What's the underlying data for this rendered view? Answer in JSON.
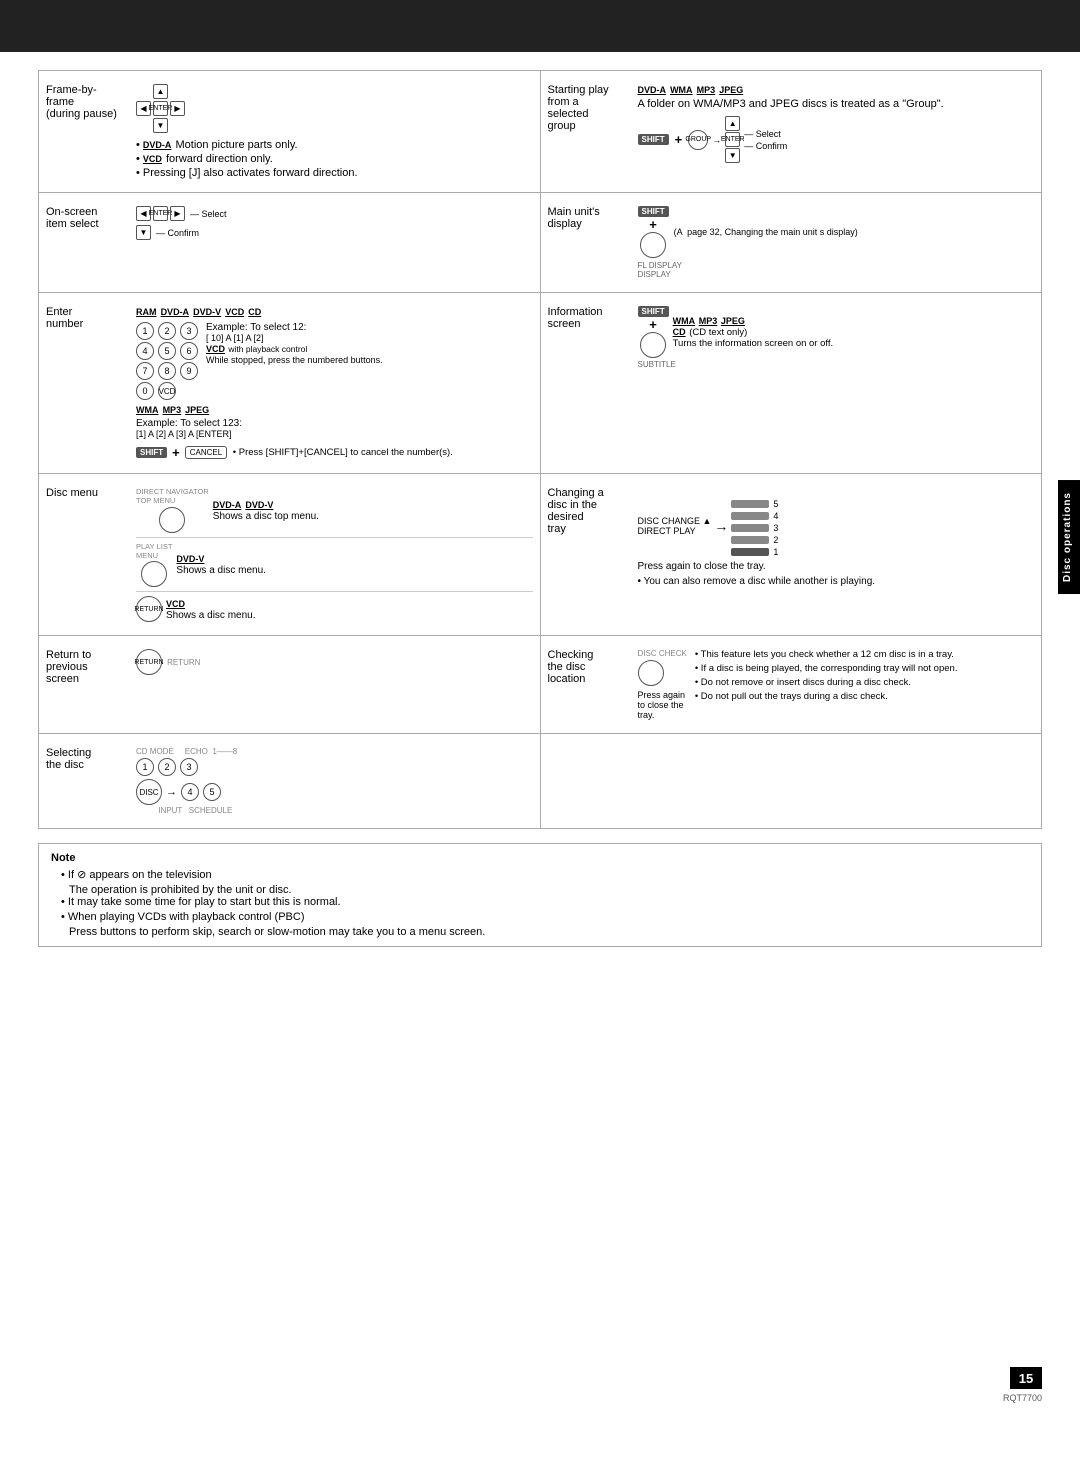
{
  "topbar": {
    "bg": "#222"
  },
  "page": {
    "number": "15",
    "code": "RQT7700"
  },
  "side_tab": {
    "label": "Disc operations"
  },
  "sections": {
    "left": [
      {
        "id": "frame-by-frame",
        "label": "Frame-by-\nframe\n(during pause)",
        "bullets": [
          {
            "badge": "DVD-A",
            "text": "Motion picture parts only."
          },
          {
            "badge": "VCD",
            "text": "forward direction only."
          },
          {
            "text": "Pressing [J] also activates forward direction."
          }
        ]
      },
      {
        "id": "on-screen-item-select",
        "label": "On-screen\nitem select",
        "select_label": "Select",
        "confirm_label": "Confirm"
      },
      {
        "id": "enter-number",
        "label": "Enter\nnumber",
        "formats": [
          "RAM",
          "DVD-A",
          "DVD-V",
          "VCD",
          "CD"
        ],
        "example1": "Example: To select 12:",
        "seq1": "[ 10] A [1] A [2]",
        "vcd_note": "VCD with playback control",
        "while_stopped": "While stopped, press the numbered buttons.",
        "formats2": [
          "WMA",
          "MP3",
          "JPEG"
        ],
        "example2": "Example: To select 123:",
        "seq2": "[1] A [2] A [3] A [ENTER]",
        "shift_note": "Press [SHIFT]+[CANCEL] to cancel the number(s)."
      },
      {
        "id": "disc-menu",
        "label": "Disc menu",
        "items": [
          {
            "formats": [
              "DVD-A",
              "DVD-V"
            ],
            "text": "Shows a disc top menu."
          },
          {
            "formats": [
              "DVD-V"
            ],
            "text": "Shows a disc menu."
          },
          {
            "formats": [
              "VCD"
            ],
            "text": "Shows a disc menu."
          }
        ]
      },
      {
        "id": "return-to-previous",
        "label": "Return to\nprevious\nscreen"
      },
      {
        "id": "selecting-disc",
        "label": "Selecting\nthe disc"
      }
    ],
    "right": [
      {
        "id": "starting-play",
        "label": "Starting play\nfrom a\nselected\ngroup",
        "top_badges": [
          "DVD-A",
          "WMA",
          "MP3",
          "JPEG"
        ],
        "group_desc": "A folder on WMA/MP3 and JPEG discs is treated as a \"Group\".",
        "select_label": "Select",
        "confirm_label": "Confirm"
      },
      {
        "id": "main-units-display",
        "label": "Main unit's\ndisplay",
        "ref": "(A  page 32, Changing the main unit s display)"
      },
      {
        "id": "information-screen",
        "label": "Information\nscreen",
        "formats": [
          "WMA",
          "MP3",
          "JPEG"
        ],
        "cd_note": "CD (CD text only)",
        "turns": "Turns the information screen on or off."
      },
      {
        "id": "changing-disc",
        "label": "Changing a\ndisc in the\ndesired\ntray",
        "press_again": "Press again to close the tray.",
        "also": "• You can also remove a disc while another is playing."
      },
      {
        "id": "checking-disc",
        "label": "Checking\nthe disc\nlocation",
        "press_again": "Press again to close the tray.",
        "bullets": [
          "This feature lets you check whether a 12 cm disc is in a tray.",
          "If a disc is being played, the corresponding tray will not open.",
          "Do not remove or insert discs during a disc check.",
          "Do not pull out the trays during a disc check."
        ]
      }
    ]
  },
  "note": {
    "title": "Note",
    "items": [
      "If  ⊘  appears on the television",
      "The operation is prohibited by the unit or disc.",
      "It may take some time for play to start but this is normal.",
      "When playing VCDs with playback control (PBC)",
      "Press buttons to perform skip, search or slow-motion may take you to a menu screen."
    ]
  }
}
